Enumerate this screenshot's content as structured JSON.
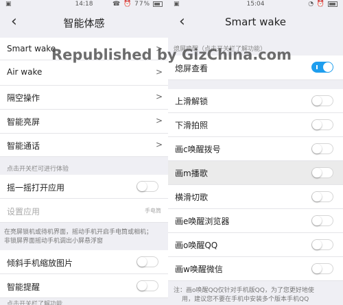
{
  "watermark": "Republished by GizChina.com",
  "left": {
    "status": {
      "time": "14:18",
      "battery": "77%",
      "left_icon": "▣",
      "right_icons": "☎ ⏰"
    },
    "title": "智能体感",
    "nav_items": [
      {
        "label": "Smart wake"
      },
      {
        "label": "Air wake"
      },
      {
        "label": "隔空操作"
      },
      {
        "label": "智能亮屏"
      },
      {
        "label": "智能通话"
      }
    ],
    "hint1": "点击开关栏可进行体验",
    "shake_label": "摇一摇打开应用",
    "settings_label": "设置应用",
    "settings_value": "手电筒",
    "desc_line1": "在亮屏锁机或待机界面，摇动手机开启手电筒或相机；",
    "desc_line2": "非锁屏界面摇动手机调出小屏悬浮窗",
    "tilt_label": "倾斜手机缩放图片",
    "smart_alert_label": "智能提醒",
    "hint2": "点击开关栏了解功能"
  },
  "right": {
    "status": {
      "time": "15:04",
      "left_icon": "▣",
      "right_icons": "◔ ⏰"
    },
    "title": "Smart wake",
    "section_hint": "熄屏唤醒（点击开关栏了解功能）",
    "screen_off_label": "熄屏查看",
    "toggle_items": [
      {
        "label": "上滑解锁"
      },
      {
        "label": "下滑拍照"
      },
      {
        "label": "画c唤醒拨号"
      },
      {
        "label": "画m播歌"
      },
      {
        "label": "横滑切歌"
      },
      {
        "label": "画e唤醒浏览器"
      },
      {
        "label": "画o唤醒QQ"
      },
      {
        "label": "画w唤醒微信"
      }
    ],
    "note_line1": "注：画o唤醒QQ仅针对手机版QQ，为了您更好地使",
    "note_line2": "用，建议您不要在手机中安装多个版本手机QQ"
  }
}
